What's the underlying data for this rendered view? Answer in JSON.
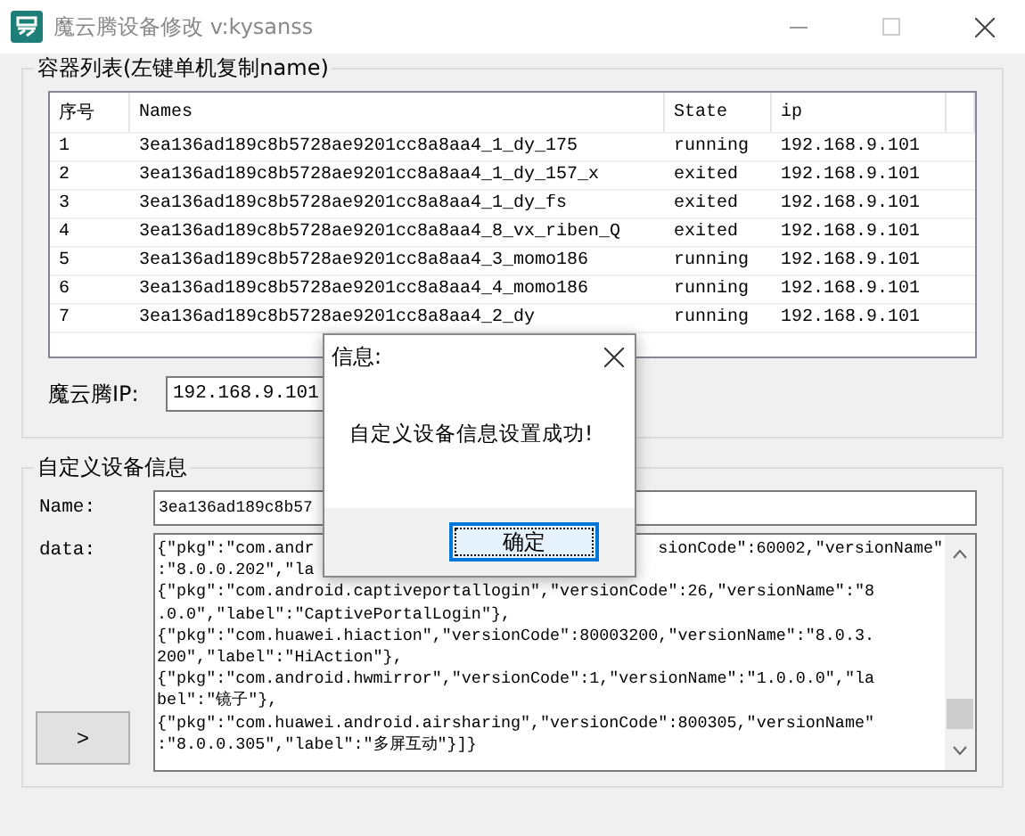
{
  "window": {
    "title": "魔云腾设备修改 v:kysanss"
  },
  "container_list": {
    "title": "容器列表(左键单机复制name)",
    "columns": [
      "序号",
      "Names",
      "State",
      "ip"
    ],
    "rows": [
      {
        "index": "1",
        "name": "3ea136ad189c8b5728ae9201cc8a8aa4_1_dy_175",
        "state": "running",
        "ip": "192.168.9.101"
      },
      {
        "index": "2",
        "name": "3ea136ad189c8b5728ae9201cc8a8aa4_1_dy_157_x",
        "state": "exited",
        "ip": "192.168.9.101"
      },
      {
        "index": "3",
        "name": "3ea136ad189c8b5728ae9201cc8a8aa4_1_dy_fs",
        "state": "exited",
        "ip": "192.168.9.101"
      },
      {
        "index": "4",
        "name": "3ea136ad189c8b5728ae9201cc8a8aa4_8_vx_riben_Q",
        "state": "exited",
        "ip": "192.168.9.101"
      },
      {
        "index": "5",
        "name": "3ea136ad189c8b5728ae9201cc8a8aa4_3_momo186",
        "state": "running",
        "ip": "192.168.9.101"
      },
      {
        "index": "6",
        "name": "3ea136ad189c8b5728ae9201cc8a8aa4_4_momo186",
        "state": "running",
        "ip": "192.168.9.101"
      },
      {
        "index": "7",
        "name": "3ea136ad189c8b5728ae9201cc8a8aa4_2_dy",
        "state": "running",
        "ip": "192.168.9.101"
      }
    ]
  },
  "ip_field": {
    "label": "魔云腾IP:",
    "value": "192.168.9.101"
  },
  "device_info": {
    "title": "自定义设备信息",
    "name_field": {
      "label": "Name:",
      "value": "3ea136ad189c8b57"
    },
    "data_field": {
      "label": "data:",
      "lines": [
        {
          "segments": [
            "{\"pkg\":\"com.andr",
            "sionCode\":60002,\"versionName\""
          ]
        },
        {
          "segments": [
            ":\"8.0.0.202\",\"la"
          ]
        },
        {
          "segments": [
            "{\"pkg\":\"com.android.captiveportallogin\",\"versionCode\":26,\"versionName\":\"8"
          ]
        },
        {
          "segments": [
            ".0.0\",\"label\":\"CaptivePortalLogin\"},"
          ]
        },
        {
          "segments": [
            "{\"pkg\":\"com.huawei.hiaction\",\"versionCode\":80003200,\"versionName\":\"8.0.3."
          ]
        },
        {
          "segments": [
            "200\",\"label\":\"HiAction\"},"
          ]
        },
        {
          "segments": [
            "{\"pkg\":\"com.android.hwmirror\",\"versionCode\":1,\"versionName\":\"1.0.0.0\",\"la"
          ]
        },
        {
          "segments": [
            "bel\":\"镜子\"},"
          ]
        },
        {
          "segments": [
            "{\"pkg\":\"com.huawei.android.airsharing\",\"versionCode\":800305,\"versionName\""
          ]
        },
        {
          "segments": [
            ":\"8.0.0.305\",\"label\":\"多屏互动\"}]}"
          ]
        }
      ]
    },
    "submit_button": ">"
  },
  "dialog": {
    "title": "信息:",
    "message": "自定义设备信息设置成功!",
    "ok_button": "确定"
  }
}
